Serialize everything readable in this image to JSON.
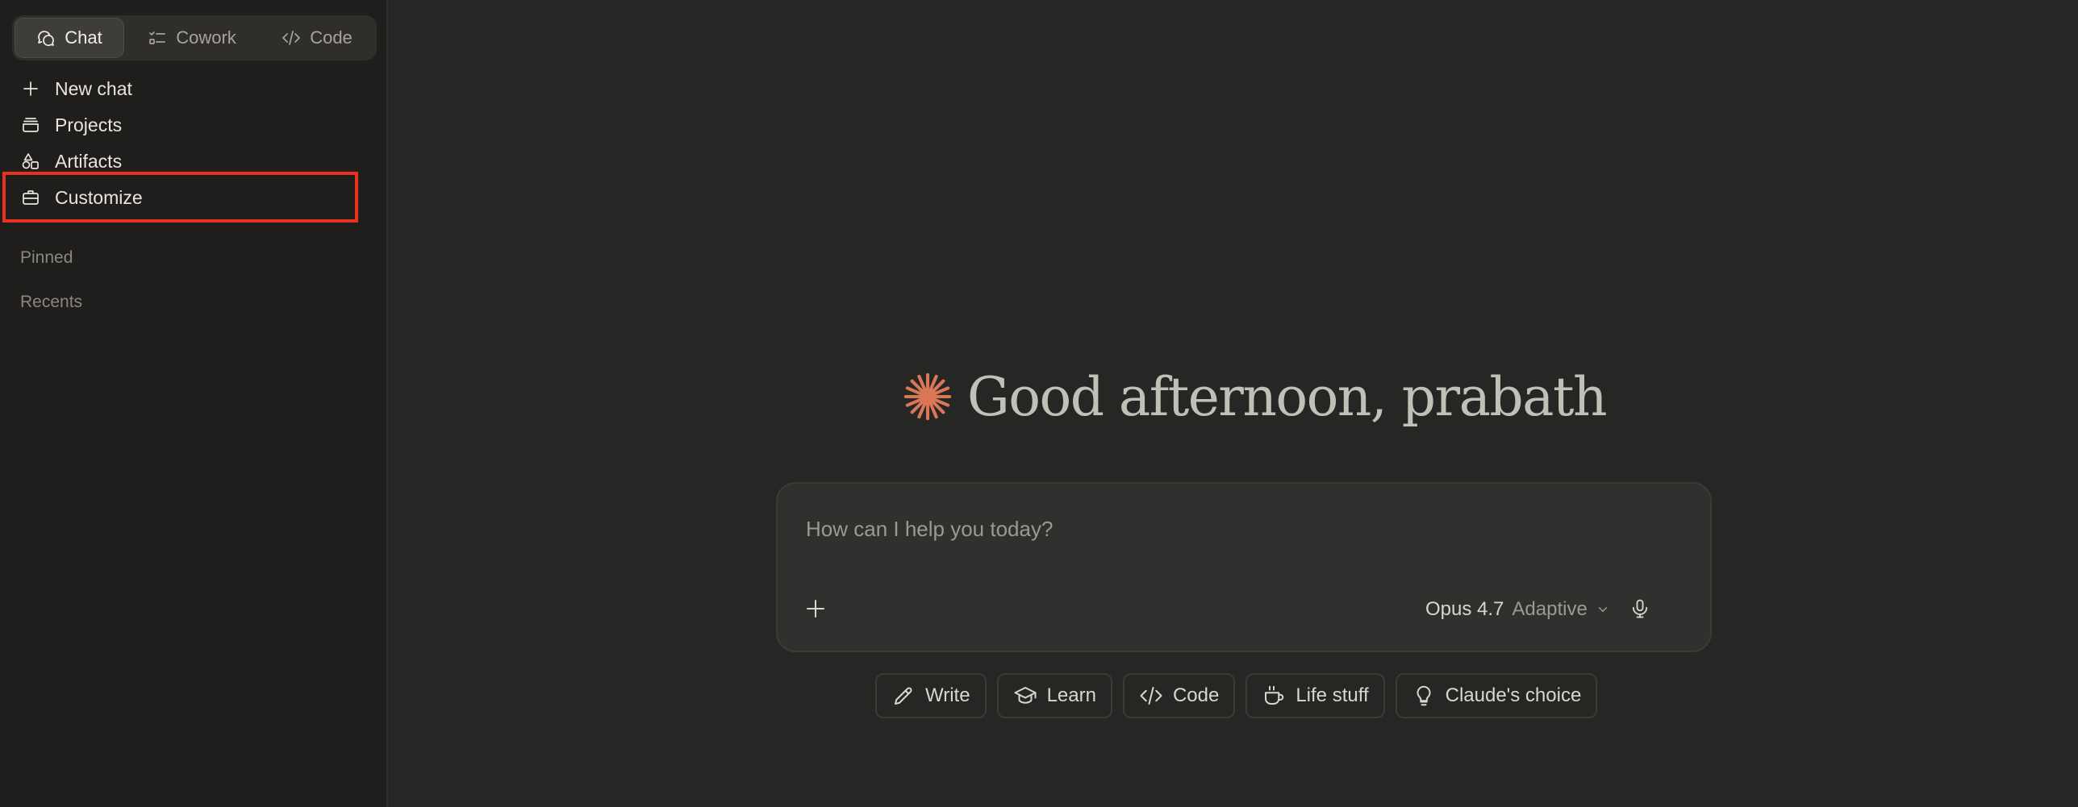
{
  "modes": {
    "chat": "Chat",
    "cowork": "Cowork",
    "code": "Code",
    "active": "chat"
  },
  "sidebar": {
    "items": [
      {
        "label": "New chat",
        "icon": "plus-icon"
      },
      {
        "label": "Projects",
        "icon": "folder-stack-icon"
      },
      {
        "label": "Artifacts",
        "icon": "shapes-icon"
      },
      {
        "label": "Customize",
        "icon": "briefcase-icon"
      }
    ],
    "pinned_label": "Pinned",
    "recents_label": "Recents"
  },
  "main": {
    "greeting": "Good afternoon, prabath",
    "composer": {
      "placeholder": "How can I help you today?",
      "model_name": "Opus 4.7",
      "model_mode": "Adaptive"
    },
    "chips": [
      {
        "label": "Write",
        "icon": "pencil-icon"
      },
      {
        "label": "Learn",
        "icon": "graduation-cap-icon"
      },
      {
        "label": "Code",
        "icon": "code-icon"
      },
      {
        "label": "Life stuff",
        "icon": "coffee-cup-icon"
      },
      {
        "label": "Claude's choice",
        "icon": "lightbulb-icon"
      }
    ]
  },
  "colors": {
    "background": "#262624",
    "sidebar": "#1f1e1d",
    "accent": "#d97757",
    "highlight": "#e8321f"
  }
}
